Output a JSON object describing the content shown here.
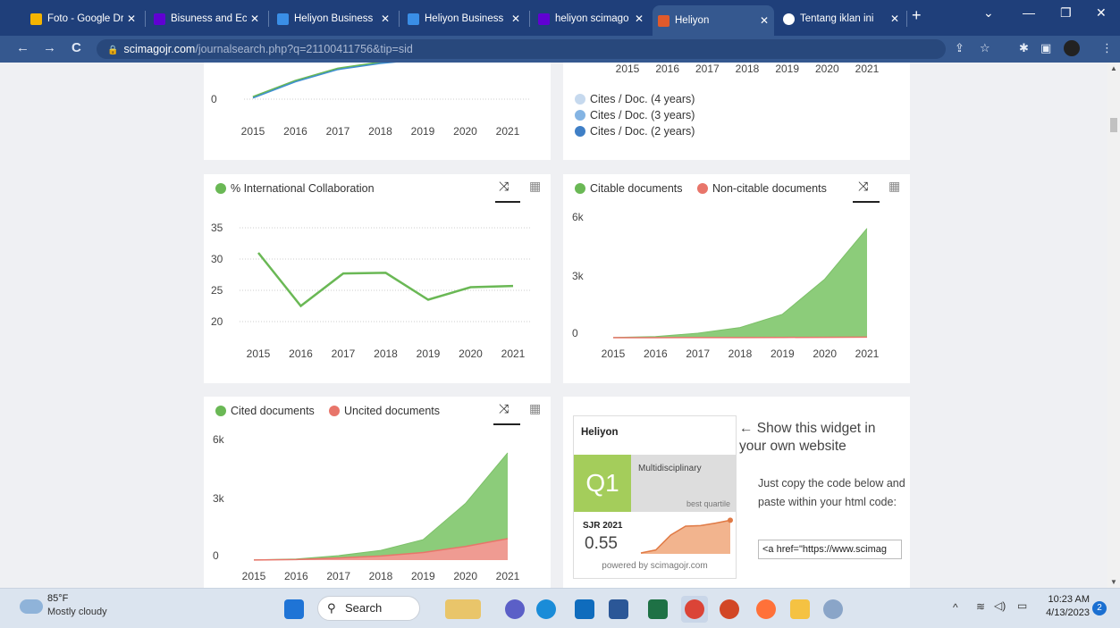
{
  "tabs": [
    {
      "label": "Foto - Google Dr",
      "fav": "#f4b400"
    },
    {
      "label": "Bisuness and Eco",
      "fav": "#6001d2"
    },
    {
      "label": "Heliyon Business",
      "fav": "#3a8ee6"
    },
    {
      "label": "Heliyon Business",
      "fav": "#3a8ee6"
    },
    {
      "label": "heliyon scimago",
      "fav": "#6001d2"
    },
    {
      "label": "Heliyon",
      "fav": "#e05a2b"
    },
    {
      "label": "Tentang iklan ini",
      "fav": "#ffffff"
    }
  ],
  "address": {
    "host": "scimagojr.com",
    "path": "/journalsearch.php?q=21100411756&tip=sid"
  },
  "top_left_chart": {
    "y_tick": "0",
    "x": [
      "2015",
      "2016",
      "2017",
      "2018",
      "2019",
      "2020",
      "2021"
    ]
  },
  "top_right_chart": {
    "x": [
      "2015",
      "2016",
      "2017",
      "2018",
      "2019",
      "2020",
      "2021"
    ],
    "legend": [
      "Cites / Doc. (4 years)",
      "Cites / Doc. (3 years)",
      "Cites / Doc. (2 years)"
    ]
  },
  "collab_chart": {
    "legend": "% International Collaboration"
  },
  "citable_chart": {
    "legend_a": "Citable documents",
    "legend_b": "Non-citable documents"
  },
  "cited_chart": {
    "legend_a": "Cited documents",
    "legend_b": "Uncited documents"
  },
  "chart_data": [
    {
      "type": "line",
      "x": [
        2015,
        2016,
        2017,
        2018,
        2019,
        2020,
        2021
      ],
      "yticks": [
        "0"
      ],
      "series": [
        {
          "values": [
            0.1,
            0.9,
            1.5,
            1.8,
            2.0,
            2.2,
            2.3
          ]
        }
      ]
    },
    {
      "type": "line",
      "x": [
        2015,
        2016,
        2017,
        2018,
        2019,
        2020,
        2021
      ],
      "yticks": [
        "20",
        "25",
        "30",
        "35"
      ],
      "series": [
        {
          "name": "% International Collaboration",
          "values": [
            31,
            22.5,
            27.7,
            27.8,
            23.5,
            25.5,
            25.7
          ]
        }
      ]
    },
    {
      "type": "area",
      "x": [
        2015,
        2016,
        2017,
        2018,
        2019,
        2020,
        2021
      ],
      "yticks": [
        "0",
        "3k",
        "6k"
      ],
      "series": [
        {
          "name": "Citable documents",
          "values": [
            10,
            60,
            230,
            520,
            1200,
            3000,
            5600
          ]
        },
        {
          "name": "Non-citable documents",
          "values": [
            0,
            2,
            5,
            8,
            12,
            20,
            30
          ]
        }
      ]
    },
    {
      "type": "area",
      "x": [
        2015,
        2016,
        2017,
        2018,
        2019,
        2020,
        2021
      ],
      "yticks": [
        "0",
        "3k",
        "6k"
      ],
      "series": [
        {
          "name": "Cited documents",
          "values": [
            10,
            60,
            230,
            500,
            1050,
            2900,
            5500
          ]
        },
        {
          "name": "Uncited documents",
          "values": [
            5,
            30,
            110,
            210,
            390,
            700,
            1100
          ]
        }
      ]
    }
  ],
  "widget": {
    "journal": "Heliyon",
    "quartile": "Q1",
    "category": "Multidisciplinary",
    "best": "best quartile",
    "sjr_label": "SJR 2021",
    "sjr_value": "0.55",
    "powered": "powered by scimagojr.com",
    "sjr_trend": [
      0.0,
      0.05,
      0.3,
      0.45,
      0.46,
      0.5,
      0.55
    ]
  },
  "promo": {
    "heading": "← Show this widget in your own website",
    "body": "Just copy the code below and paste within your html code:",
    "code": "<a href=\"https://www.scimag"
  },
  "colors": {
    "green": "#6ab855",
    "greenFill": "#8ccc7a",
    "red": "#e8756a",
    "blue": "#3f8fd2"
  },
  "taskbar": {
    "weather_temp": "85°F",
    "weather_desc": "Mostly cloudy",
    "search": "Search",
    "time": "10:23 AM",
    "date": "4/13/2023",
    "badge": "2"
  }
}
